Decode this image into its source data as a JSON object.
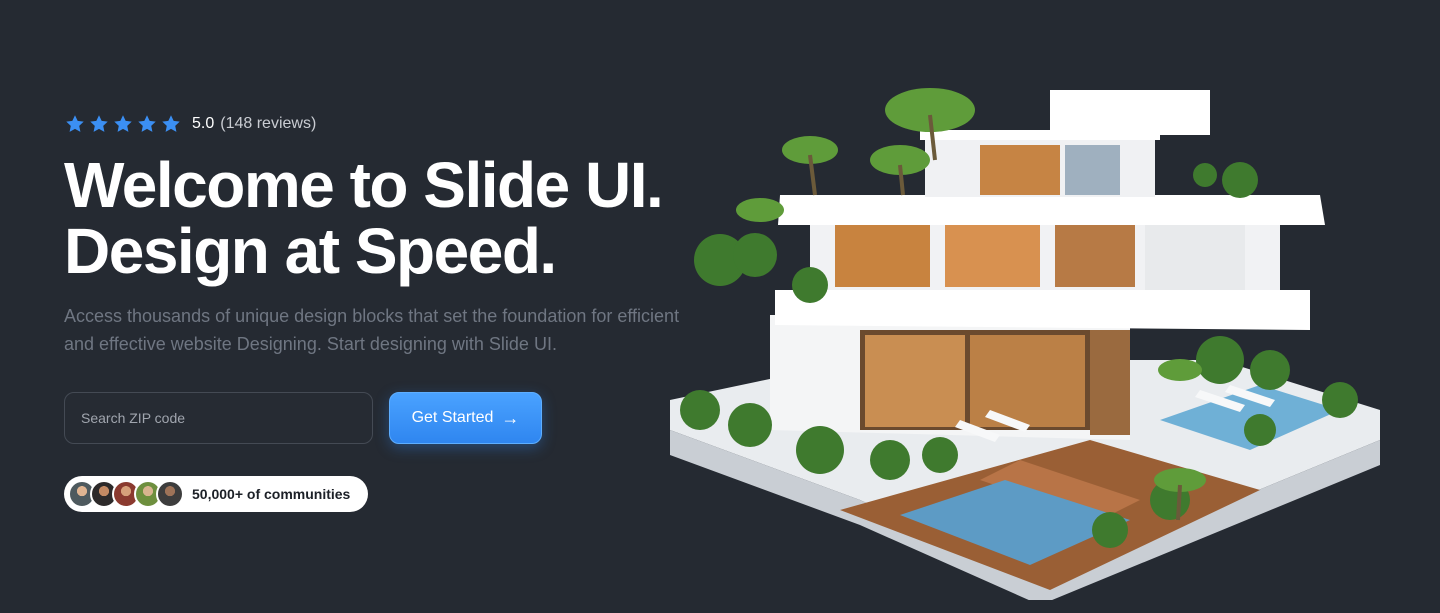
{
  "rating": {
    "star_count": 5,
    "star_color": "#3b8ff3",
    "score": "5.0",
    "reviews": "(148 reviews)"
  },
  "headline": {
    "line1": "Welcome to Slide UI.",
    "line2": "Design at Speed."
  },
  "subtext": "Access thousands of unique design blocks that set the foundation for efficient and effective website Designing. Start designing with Slide UI.",
  "search": {
    "placeholder": "Search ZIP code",
    "value": ""
  },
  "cta": {
    "label": "Get Started",
    "icon": "arrow-right-icon"
  },
  "community": {
    "label": "50,000+ of communities",
    "avatar_count": 5
  },
  "hero_image": {
    "subject": "house-illustration"
  },
  "colors": {
    "background": "#252a32",
    "accent": "#3b8ff3",
    "muted_text": "#6f7682"
  }
}
